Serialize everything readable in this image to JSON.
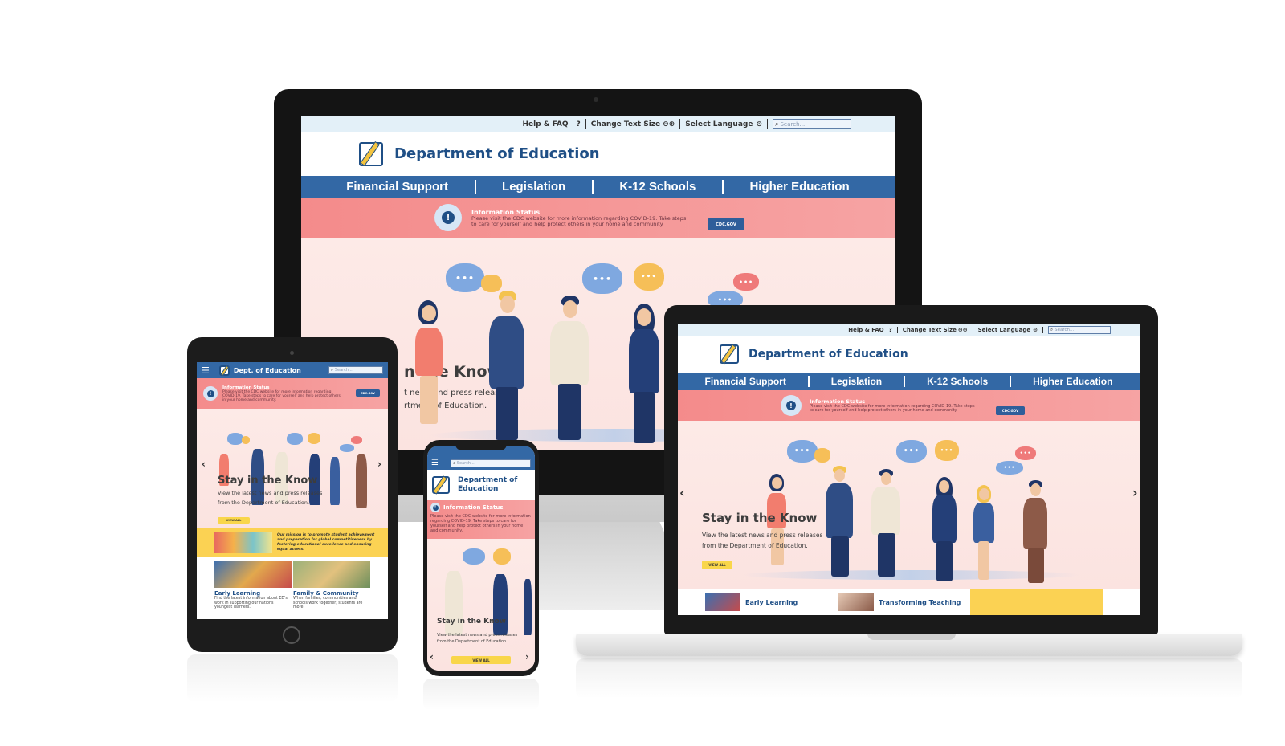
{
  "site": {
    "utility": {
      "help": "Help & FAQ",
      "help_icon": "?",
      "text_size": "Change Text Size",
      "text_size_icons": "⊖⊕",
      "language": "Select Language",
      "language_icon": "⊙",
      "search_placeholder": "Search..."
    },
    "brand": {
      "title": "Department of Education",
      "title_short": "Dept. of Education",
      "title_phone_1": "Department of",
      "title_phone_2": "Education"
    },
    "nav": [
      "Financial Support",
      "Legislation",
      "K-12 Schools",
      "Higher Education"
    ],
    "alert": {
      "title": "Information Status",
      "message": "Please visit the CDC website for more information regarding COVID-19. Take steps to care for yourself and help protect others in your home and community.",
      "button": "CDC.GOV",
      "icon": "!"
    },
    "hero": {
      "title": "Stay in the Know",
      "title_partial": "n the Know",
      "subtitle_1": "View the latest news and press releases",
      "subtitle_2": "from the Department of Education.",
      "subtitle_partial_1": "t news and press releases",
      "subtitle_partial_2": "rtment of Education.",
      "button": "VIEW ALL",
      "prev": "‹",
      "next": "›",
      "bubble_dots": "•••"
    },
    "mission": {
      "text": "Our mission is to promote student achievement and preparation for global competitiveness by fostering educational excellence and ensuring equal access."
    },
    "cards": [
      {
        "title": "Early Learning",
        "text": "Find the latest information about ED's work in supporting our nations youngest learners."
      },
      {
        "title": "Family & Community",
        "text": "When families, communities and schools work together, students are more"
      },
      {
        "title": "Transforming Teaching",
        "text": ""
      }
    ]
  },
  "colors": {
    "navy": "#1f4f86",
    "nav_blue": "#3368a5",
    "alert_pink": "#f48b8b",
    "hero_bg": "#fdeae7",
    "accent_yellow": "#f9d64a"
  }
}
